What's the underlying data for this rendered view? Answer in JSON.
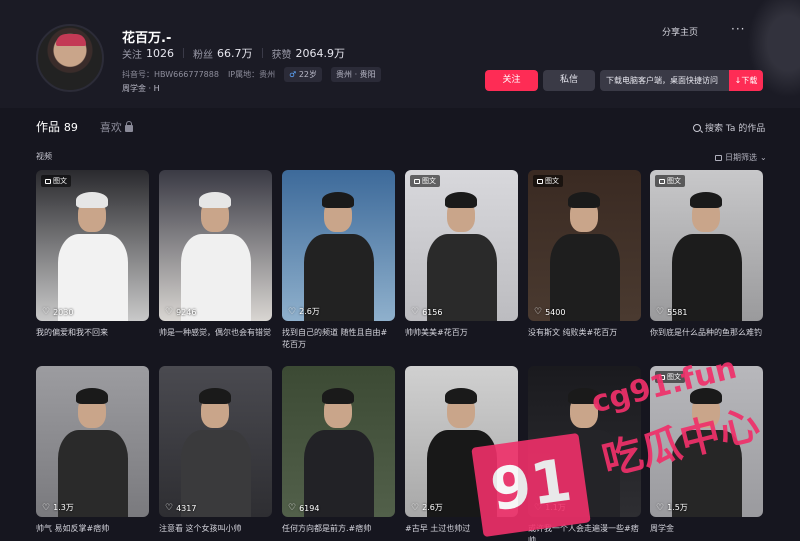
{
  "profile": {
    "name": "花百万.-",
    "following_label": "关注",
    "following_value": "1026",
    "followers_label": "粉丝",
    "followers_value": "66.7万",
    "likes_label": "获赞",
    "likes_value": "2064.9万",
    "douyin_id": "抖音号：HBW666777888",
    "ip": "IP属地：贵州",
    "age": "22岁",
    "location": "贵州 · 贵阳",
    "school": "周学金 · H",
    "share_label": "分享主页",
    "more_label": "···",
    "follow_button": "关注",
    "message_button": "私信",
    "download_text": "下载电脑客户端，桌面快捷访问",
    "download_button": "下载"
  },
  "tabs": {
    "works_label": "作品",
    "works_count": "89",
    "likes_label": "喜欢"
  },
  "search_label": "搜索 Ta 的作品",
  "section_label": "视频",
  "sort_label": "日期筛选",
  "badge_label": "图文",
  "cards": [
    {
      "likes": "2030",
      "caption": "我的偏爱和我不回来",
      "badge": true
    },
    {
      "likes": "9246",
      "caption": "帅是一种感觉，偶尔也会有错觉",
      "badge": false
    },
    {
      "likes": "2.6万",
      "caption": "找到自己的频道 随性且自由#花百万",
      "badge": false
    },
    {
      "likes": "6156",
      "caption": "帅帅美美#花百万",
      "badge": true
    },
    {
      "likes": "5400",
      "caption": "没有斯文 纯败类#花百万",
      "badge": true
    },
    {
      "likes": "5581",
      "caption": "你到底是什么品种的鱼那么难钓",
      "badge": true
    },
    {
      "likes": "1.3万",
      "caption": "帅气 易如反掌#痞帅",
      "badge": false
    },
    {
      "likes": "4317",
      "caption": "注意看 这个女孩叫小帅",
      "badge": false
    },
    {
      "likes": "6194",
      "caption": "任何方向都是前方.#痞帅",
      "badge": false
    },
    {
      "likes": "2.6万",
      "caption": "#古早 土过也帅过",
      "badge": false
    },
    {
      "likes": "1.1万",
      "caption": "或许我一个人会走遍漫一些#痞帅",
      "badge": false
    },
    {
      "likes": "1.5万",
      "caption": "周学金",
      "badge": true
    }
  ],
  "watermark": {
    "number": "91",
    "domain": "cg91.fun",
    "name": "吃瓜中心"
  },
  "colors": {
    "accent": "#fe2c55",
    "bg": "#16161f"
  }
}
